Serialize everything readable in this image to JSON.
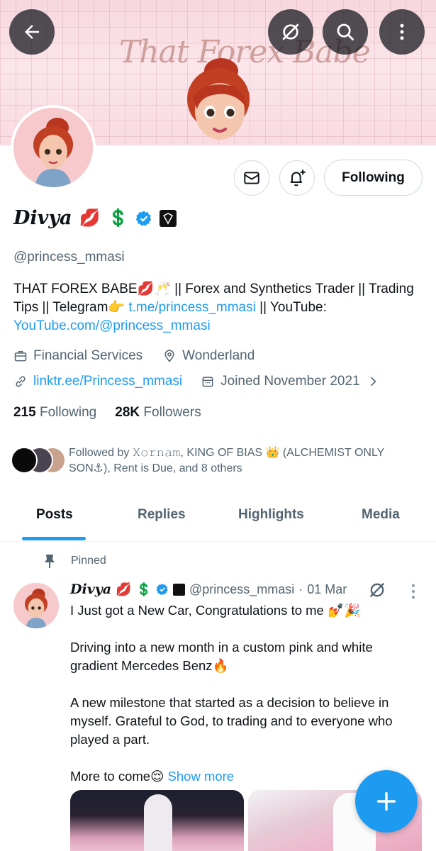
{
  "banner": {
    "brand_text": "That Forex Babe"
  },
  "profile": {
    "name": "Divya",
    "name_emojis": [
      "💋",
      "💲"
    ],
    "handle": "@princess_mmasi",
    "following_button": "Following",
    "bio": {
      "text1": "THAT FOREX BABE💋🥂 || Forex and Synthetics Trader || Trading Tips || Telegram👉 ",
      "link1": "t.me/princess_mmasi",
      "text2": " || YouTube: ",
      "link2": "YouTube.com/@princess_mmasi"
    },
    "category": "Financial Services",
    "location": "Wonderland",
    "website": "linktr.ee/Princess_mmasi",
    "joined": "Joined November 2021",
    "following_count": "215",
    "following_label": "Following",
    "followers_count": "28K",
    "followers_label": "Followers",
    "followed_by": "Followed by 𝚇𝚘𝚛𝚗𝚊𝚖, KING OF BIAS 👑 (ALCHEMIST ONLY SON⚓), Rent is Due, and 8 others"
  },
  "tabs": [
    {
      "label": "Posts",
      "active": true
    },
    {
      "label": "Replies",
      "active": false
    },
    {
      "label": "Highlights",
      "active": false
    },
    {
      "label": "Media",
      "active": false
    }
  ],
  "tweet": {
    "pinned_label": "Pinned",
    "name": "Divya",
    "name_emojis": [
      "💋",
      "💲"
    ],
    "handle": "@princess_mmasi",
    "dot": "·",
    "date": "01 Mar",
    "paragraphs": [
      "I Just got a New Car, Congratulations to me 💅🎉",
      "Driving into a new month in a custom pink and white gradient Mercedes Benz🔥",
      "A new milestone that started as a decision to believe in myself. Grateful to God, to trading and to everyone who played a part."
    ],
    "last_line": "More to come😌 ",
    "show_more": "Show more"
  },
  "colors": {
    "accent": "#1d9bf0",
    "secondary_text": "#536471",
    "border": "#cfd9de"
  },
  "icons": [
    "back-arrow-icon",
    "grok-icon",
    "search-icon",
    "more-vertical-icon",
    "mail-icon",
    "bell-plus-icon",
    "verified-badge-icon",
    "briefcase-icon",
    "location-pin-icon",
    "link-icon",
    "calendar-icon",
    "chevron-right-icon",
    "pin-icon",
    "plus-icon"
  ]
}
